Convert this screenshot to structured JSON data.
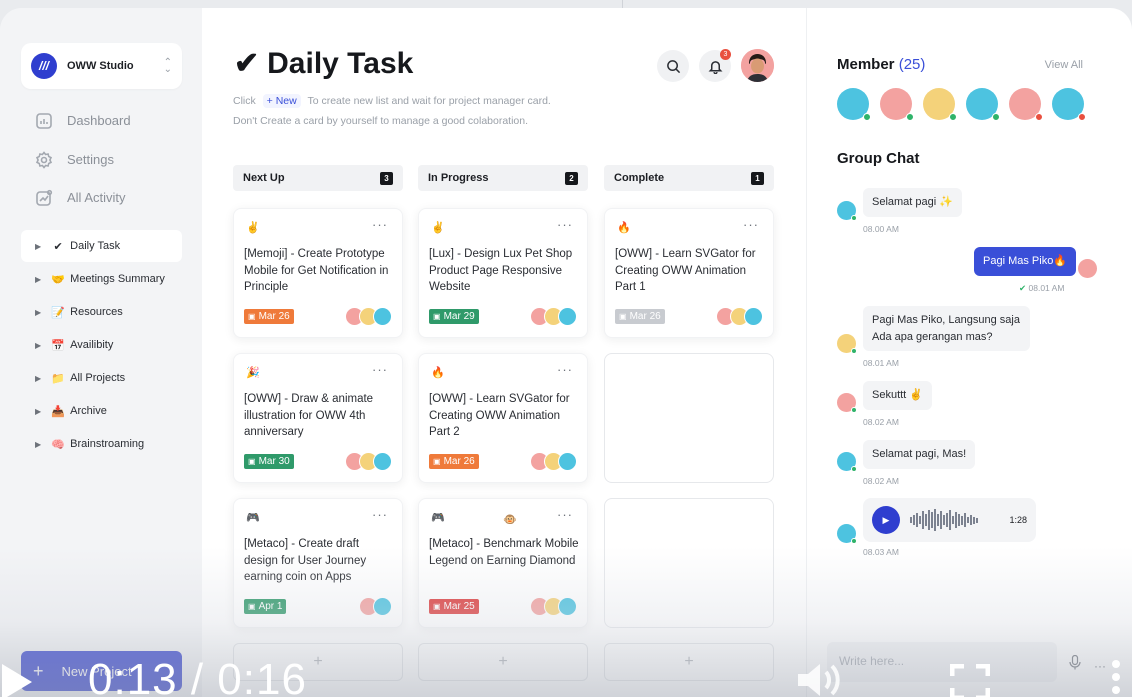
{
  "workspace": {
    "logo": "///",
    "name": "OWW Studio"
  },
  "nav": [
    {
      "label": "Dashboard",
      "icon": "dashboard-icon"
    },
    {
      "label": "Settings",
      "icon": "gear-icon"
    },
    {
      "label": "All Activity",
      "icon": "activity-icon"
    }
  ],
  "tree": [
    {
      "emoji": "✔",
      "label": "Daily Task"
    },
    {
      "emoji": "🤝",
      "label": "Meetings Summary"
    },
    {
      "emoji": "📝",
      "label": "Resources"
    },
    {
      "emoji": "📅",
      "label": "Availibity"
    },
    {
      "emoji": "📁",
      "label": "All Projects"
    },
    {
      "emoji": "📥",
      "label": "Archive"
    },
    {
      "emoji": "🧠",
      "label": "Brainstroaming"
    }
  ],
  "new_project_label": "New Project",
  "page": {
    "check": "✔",
    "title": "Daily Task",
    "hint_click": "Click",
    "hint_new": "+ New",
    "hint_rest": "To create new list and wait for project manager card.",
    "hint_line2": "Don't Create a card by yourself to manage a good colaboration.",
    "notifications": "3"
  },
  "columns": [
    {
      "name": "Next Up",
      "count": "3"
    },
    {
      "name": "In Progress",
      "count": "2"
    },
    {
      "name": "Complete",
      "count": "1"
    }
  ],
  "cards": [
    {
      "emoji": "✌",
      "title": "[Memoji] - Create Prototype Mobile for Get Notification in Principle",
      "date": "Mar 26",
      "color": "#ef7a3a"
    },
    {
      "emoji": "🎉",
      "title": "[OWW] - Draw & animate illustration for OWW 4th anniversary",
      "date": "Mar 30",
      "color": "#2f9a6a"
    },
    {
      "emoji": "🎮",
      "title": "[Metaco] - Create draft design for User Journey earning coin on Apps",
      "date": "Apr 1",
      "color": "#2f9a6a"
    },
    {
      "emoji": "✌",
      "title": "[Lux] - Design Lux Pet Shop Product Page Responsive Website",
      "date": "Mar 29",
      "color": "#2f9a6a"
    },
    {
      "emoji": "🔥",
      "title": "[OWW] - Learn SVGator for Creating OWW Animation Part 2",
      "date": "Mar 26",
      "color": "#ef7a3a"
    },
    {
      "emoji": "🎮",
      "emoji2": "🐵",
      "title": "[Metaco] - Benchmark Mobile Legend on Earning Diamond",
      "date": "Mar 25",
      "color": "#dd3b3b"
    },
    {
      "emoji": "🔥",
      "title": "[OWW] - Learn SVGator for Creating OWW Animation Part 1",
      "date": "Mar 26",
      "color": "#c8cbd0"
    }
  ],
  "members": {
    "title": "Member",
    "count": "(25)",
    "view_all": "View All"
  },
  "chat": {
    "title": "Group Chat",
    "messages": [
      {
        "text": "Selamat pagi ✨",
        "time": "08.00 AM"
      },
      {
        "text": "Pagi Mas Piko🔥",
        "time": "08.01 AM"
      },
      {
        "text": "Pagi Mas Piko, Langsung saja Ada apa gerangan mas?",
        "time": "08.01 AM"
      },
      {
        "text": "Sekuttt ✌",
        "time": "08.02 AM"
      },
      {
        "text": "Selamat pagi, Mas!",
        "time": "08.02 AM"
      },
      {
        "voice_duration": "1:28",
        "time": "08.03 AM"
      }
    ],
    "placeholder": "Write here..."
  },
  "video": {
    "timecode": "0:13 / 0:16"
  }
}
